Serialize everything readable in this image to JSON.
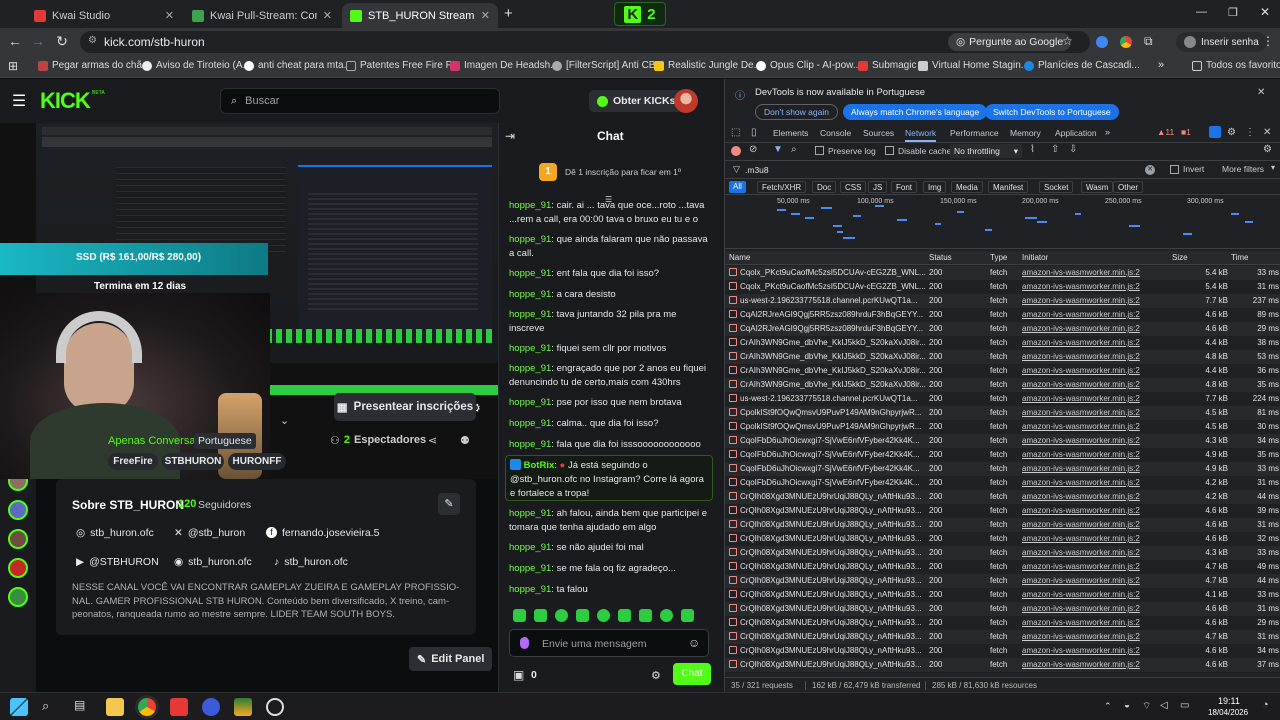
{
  "browser": {
    "tabs": [
      {
        "title": "Kwai Studio",
        "color": "#e53935"
      },
      {
        "title": "Kwai Pull-Stream: Como Funcio",
        "color": "#3fa34d"
      },
      {
        "title": "STB_HURON Stream - Watch Li",
        "color": "#53fc18"
      }
    ],
    "new_tab": "+",
    "extension_badge": "2",
    "url": "kick.com/stb-huron",
    "ask_google": "Pergunte ao Google",
    "profile": "Inserir senha",
    "bookmarks": [
      "Pegar armas do chã...",
      "Aviso de Tiroteio (A...",
      "anti cheat para mta...",
      "Patentes Free Fire P...",
      "Imagen De Headsh...",
      "[FilterScript] Anti CB...",
      "Realistic Jungle De...",
      "Opus Clip - AI-pow...",
      "Submagic",
      "Virtual Home Stagin...",
      "Planícies de Cascadi..."
    ],
    "all_bookmarks": "Todos os favoritos"
  },
  "kick": {
    "logo": "KICK",
    "beta": "BETA",
    "search_placeholder": "Buscar",
    "get_kicks": "Obter KICKs",
    "overlay_goal": "SSD (R$ 161,00/R$ 280,00)",
    "overlay_ends": "Termina em 12 dias",
    "subscriptions_button": "Presentear inscrições",
    "category": "Apenas Conversa",
    "language": "Portuguese",
    "viewers_count": "2",
    "viewers_label": "Espectadores",
    "tags": [
      "FreeFire",
      "STBHURON",
      "HURONFF"
    ],
    "about_title": "Sobre STB_HURON",
    "followers_count": "120",
    "followers_label": "Seguidores",
    "socials": [
      "stb_huron.ofc",
      "@stb_huron",
      "fernando.josevieira.5",
      "@STBHURON",
      "stb_huron.ofc",
      "stb_huron.ofc"
    ],
    "description": "NESSE CANAL VOCÊ VAI ENCONTRAR GAMEPLAY ZUEIRA E GAMEPLAY PROFISSIO-NAL. GAMER PROFISSIONAL STB HURON. Conteúdo bem diversificado, X treino, cam-peonatos, ranqueada rumo ao mestre sempre. LIDER TEAM SOUTH BOYS.",
    "edit_panel": "Edit Panel"
  },
  "chat": {
    "title": "Chat",
    "pinned_rank": "1",
    "pinned_text": "Dê 1 inscrição para ficar em 1º",
    "messages": [
      {
        "user": "hoppe_91",
        "text": "cair. ai ... tava que oce...roto ...tava ...rem a call, era 00:00 tava o bruxo eu tu e o zezin"
      },
      {
        "user": "hoppe_91",
        "text": "que ainda falaram que não passava a call."
      },
      {
        "user": "hoppe_91",
        "text": "ent fala que dia foi isso?"
      },
      {
        "user": "hoppe_91",
        "text": "a cara desisto"
      },
      {
        "user": "hoppe_91",
        "text": "tava juntando 32 pila pra me inscreve"
      },
      {
        "user": "hoppe_91",
        "text": "fiquei sem cllr por motivos"
      },
      {
        "user": "hoppe_91",
        "text": "engraçado que por 2 anos eu fiquei denuncindo tu de certo,mais com 430hrs"
      },
      {
        "user": "hoppe_91",
        "text": "pse por isso que nem brotava"
      },
      {
        "user": "hoppe_91",
        "text": "calma.. que dia foi isso?"
      },
      {
        "user": "hoppe_91",
        "text": "fala que dia foi isssoooooooooooo"
      },
      {
        "user": "BotRix",
        "text": "Já está seguindo o @stb_huron.ofc no Instagram? Corre lá agora e fortalece a tropa!"
      },
      {
        "user": "hoppe_91",
        "text": "ah falou, ainda bem que participei e tomara que tenha ajudado em algo"
      },
      {
        "user": "hoppe_91",
        "text": "se não ajudei foi mal"
      },
      {
        "user": "hoppe_91",
        "text": "se me fala oq fiz agradeço..."
      },
      {
        "user": "hoppe_91",
        "text": "ta falou"
      }
    ],
    "input_placeholder": "Envie uma mensagem",
    "kicks_count": "0",
    "send_label": "Chat"
  },
  "devtools": {
    "notice": "DevTools is now available in Portuguese",
    "btn_dont_show": "Don't show again",
    "btn_match": "Always match Chrome's language",
    "btn_switch": "Switch DevTools to Portuguese",
    "tabs": [
      "Elements",
      "Console",
      "Sources",
      "Network",
      "Performance",
      "Memory",
      "Application"
    ],
    "active_tab": "Network",
    "warn_count": "11",
    "err_count": "1",
    "preserve_log": "Preserve log",
    "disable_cache": "Disable cache",
    "throttling": "No throttling",
    "filter_value": ".m3u8",
    "invert": "Invert",
    "more_filters": "More filters",
    "types": [
      "All",
      "Fetch/XHR",
      "Doc",
      "CSS",
      "JS",
      "Font",
      "Img",
      "Media",
      "Manifest",
      "Socket",
      "Wasm",
      "Other"
    ],
    "timeline_labels": [
      "50,000 ms",
      "100,000 ms",
      "150,000 ms",
      "200,000 ms",
      "250,000 ms",
      "300,000 ms"
    ],
    "columns": [
      "Name",
      "Status",
      "Type",
      "Initiator",
      "Size",
      "Time"
    ],
    "rows": [
      [
        "Cqolx_PKct9uCaofMc5zsI5DCUAv-cEG2ZB_WNL...",
        "200",
        "fetch",
        "amazon-ivs-wasmworker.min.js:2",
        "5.4 kB",
        "33 ms"
      ],
      [
        "Cqolx_PKct9uCaofMc5zsI5DCUAv-cEG2ZB_WNL...",
        "200",
        "fetch",
        "amazon-ivs-wasmworker.min.js:2",
        "5.4 kB",
        "31 ms"
      ],
      [
        "us-west-2.196233775518.channel.pcrKUwQT1a...",
        "200",
        "fetch",
        "amazon-ivs-wasmworker.min.js:2",
        "7.7 kB",
        "237 ms"
      ],
      [
        "CqAI2RJreAGI9Qgj5RR5zsz089hrduF3hBqGEYY...",
        "200",
        "fetch",
        "amazon-ivs-wasmworker.min.js:2",
        "4.6 kB",
        "89 ms"
      ],
      [
        "CqAI2RJreAGI9Qgj5RR5zsz089hrduF3hBqGEYY...",
        "200",
        "fetch",
        "amazon-ivs-wasmworker.min.js:2",
        "4.6 kB",
        "29 ms"
      ],
      [
        "CrAIh3WN9Gme_dbVhe_KkIJ5kkD_S20kaXvJ08ir...",
        "200",
        "fetch",
        "amazon-ivs-wasmworker.min.js:2",
        "4.4 kB",
        "38 ms"
      ],
      [
        "CrAIh3WN9Gme_dbVhe_KkIJ5kkD_S20kaXvJ08ir...",
        "200",
        "fetch",
        "amazon-ivs-wasmworker.min.js:2",
        "4.8 kB",
        "53 ms"
      ],
      [
        "CrAIh3WN9Gme_dbVhe_KkIJ5kkD_S20kaXvJ08ir...",
        "200",
        "fetch",
        "amazon-ivs-wasmworker.min.js:2",
        "4.4 kB",
        "36 ms"
      ],
      [
        "CrAIh3WN9Gme_dbVhe_KkIJ5kkD_S20kaXvJ08ir...",
        "200",
        "fetch",
        "amazon-ivs-wasmworker.min.js:2",
        "4.8 kB",
        "35 ms"
      ],
      [
        "us-west-2.196233775518.channel.pcrKUwQT1a...",
        "200",
        "fetch",
        "amazon-ivs-wasmworker.min.js:2",
        "7.7 kB",
        "224 ms"
      ],
      [
        "CpolkISt9fOQwQmsvU9PuvP149AM9nGhpyrjwR...",
        "200",
        "fetch",
        "amazon-ivs-wasmworker.min.js:2",
        "4.5 kB",
        "81 ms"
      ],
      [
        "CpolkISt9fOQwQmsvU9PuvP149AM9nGhpyrjwR...",
        "200",
        "fetch",
        "amazon-ivs-wasmworker.min.js:2",
        "4.5 kB",
        "30 ms"
      ],
      [
        "CqoIFbD6uJhOicwxgi7-SjVwE6nfVFyber42Kk4K...",
        "200",
        "fetch",
        "amazon-ivs-wasmworker.min.js:2",
        "4.3 kB",
        "34 ms"
      ],
      [
        "CqoIFbD6uJhOicwxgi7-SjVwE6nfVFyber42Kk4K...",
        "200",
        "fetch",
        "amazon-ivs-wasmworker.min.js:2",
        "4.9 kB",
        "35 ms"
      ],
      [
        "CqoIFbD6uJhOicwxgi7-SjVwE6nfVFyber42Kk4K...",
        "200",
        "fetch",
        "amazon-ivs-wasmworker.min.js:2",
        "4.9 kB",
        "33 ms"
      ],
      [
        "CqoIFbD6uJhOicwxgi7-SjVwE6nfVFyber42Kk4K...",
        "200",
        "fetch",
        "amazon-ivs-wasmworker.min.js:2",
        "4.2 kB",
        "31 ms"
      ],
      [
        "CrQIh08Xgd3MNUEzU9hrUqiJ88QLy_nAftHku93...",
        "200",
        "fetch",
        "amazon-ivs-wasmworker.min.js:2",
        "4.2 kB",
        "44 ms"
      ],
      [
        "CrQIh08Xgd3MNUEzU9hrUqiJ88QLy_nAftHku93...",
        "200",
        "fetch",
        "amazon-ivs-wasmworker.min.js:2",
        "4.6 kB",
        "39 ms"
      ],
      [
        "CrQIh08Xgd3MNUEzU9hrUqiJ88QLy_nAftHku93...",
        "200",
        "fetch",
        "amazon-ivs-wasmworker.min.js:2",
        "4.6 kB",
        "31 ms"
      ],
      [
        "CrQIh08Xgd3MNUEzU9hrUqiJ88QLy_nAftHku93...",
        "200",
        "fetch",
        "amazon-ivs-wasmworker.min.js:2",
        "4.6 kB",
        "32 ms"
      ],
      [
        "CrQIh08Xgd3MNUEzU9hrUqiJ88QLy_nAftHku93...",
        "200",
        "fetch",
        "amazon-ivs-wasmworker.min.js:2",
        "4.3 kB",
        "33 ms"
      ],
      [
        "CrQIh08Xgd3MNUEzU9hrUqiJ88QLy_nAftHku93...",
        "200",
        "fetch",
        "amazon-ivs-wasmworker.min.js:2",
        "4.7 kB",
        "49 ms"
      ],
      [
        "CrQIh08Xgd3MNUEzU9hrUqiJ88QLy_nAftHku93...",
        "200",
        "fetch",
        "amazon-ivs-wasmworker.min.js:2",
        "4.7 kB",
        "44 ms"
      ],
      [
        "CrQIh08Xgd3MNUEzU9hrUqiJ88QLy_nAftHku93...",
        "200",
        "fetch",
        "amazon-ivs-wasmworker.min.js:2",
        "4.1 kB",
        "33 ms"
      ],
      [
        "CrQIh08Xgd3MNUEzU9hrUqiJ88QLy_nAftHku93...",
        "200",
        "fetch",
        "amazon-ivs-wasmworker.min.js:2",
        "4.6 kB",
        "31 ms"
      ],
      [
        "CrQIh08Xgd3MNUEzU9hrUqiJ88QLy_nAftHku93...",
        "200",
        "fetch",
        "amazon-ivs-wasmworker.min.js:2",
        "4.6 kB",
        "29 ms"
      ],
      [
        "CrQIh08Xgd3MNUEzU9hrUqiJ88QLy_nAftHku93...",
        "200",
        "fetch",
        "amazon-ivs-wasmworker.min.js:2",
        "4.7 kB",
        "31 ms"
      ],
      [
        "CrQIh08Xgd3MNUEzU9hrUqiJ88QLy_nAftHku93...",
        "200",
        "fetch",
        "amazon-ivs-wasmworker.min.js:2",
        "4.6 kB",
        "34 ms"
      ],
      [
        "CrQIh08Xgd3MNUEzU9hrUqiJ88QLy_nAftHku93...",
        "200",
        "fetch",
        "amazon-ivs-wasmworker.min.js:2",
        "4.6 kB",
        "37 ms"
      ]
    ],
    "status_requests": "35 / 321 requests",
    "status_transferred": "162 kB / 62,479 kB transferred",
    "status_resources": "285 kB / 81,630 kB resources"
  },
  "taskbar": {
    "time": "19:11",
    "date": "18/04/2026"
  },
  "colors": {
    "kick_green": "#53fc18",
    "devtools_blue": "#8ab4f8",
    "error_red": "#f28b82"
  }
}
